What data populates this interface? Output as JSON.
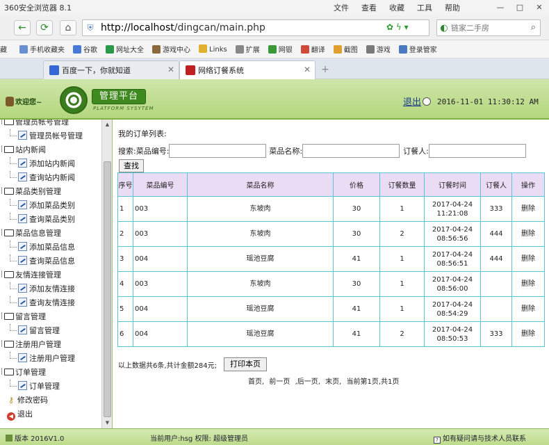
{
  "browser": {
    "app_title": "360安全浏览器 8.1",
    "menus": [
      "文件",
      "查看",
      "收藏",
      "工具",
      "帮助"
    ],
    "url_host": "http://localhost",
    "url_path": "/dingcan/main.php",
    "search_placeholder": "链家二手房",
    "favorites": [
      {
        "label": "藏",
        "color": "#d7a12a"
      },
      {
        "label": "手机收藏夹",
        "color": "#6a8fd0"
      },
      {
        "label": "谷歌",
        "color": "#4a78d6"
      },
      {
        "label": "网址大全",
        "color": "#2a9a4a"
      },
      {
        "label": "游戏中心",
        "color": "#8a6a3a"
      },
      {
        "label": "Links",
        "color": "#e0b030"
      },
      {
        "label": "扩展",
        "color": "#888888"
      },
      {
        "label": "网银",
        "color": "#3a9a3a"
      },
      {
        "label": "翻译",
        "color": "#d04a3a"
      },
      {
        "label": "截图",
        "color": "#e0a030"
      },
      {
        "label": "游戏",
        "color": "#7a7a7a"
      },
      {
        "label": "登录管家",
        "color": "#4a7ac0"
      }
    ],
    "tabs": [
      {
        "label": "百度一下，你就知道",
        "icon_color": "#3466d6"
      },
      {
        "label": "网络订餐系统",
        "icon_color": "#c02020"
      }
    ],
    "accent": "#7fb03f"
  },
  "header": {
    "welcome": "欢迎您~",
    "brand": "管理平台",
    "brand_sub": "PLATFORM SYSYTEM",
    "logout": "退出",
    "datetime": "2016-11-01 11:30:12 AM"
  },
  "sidebar": {
    "items": [
      {
        "label": "管理员帐号管理",
        "level": 0
      },
      {
        "label": "管理员帐号管理",
        "level": 1
      },
      {
        "label": "站内新闻",
        "level": 0
      },
      {
        "label": "添加站内新闻",
        "level": 1
      },
      {
        "label": "查询站内新闻",
        "level": 1
      },
      {
        "label": "菜品类别管理",
        "level": 0
      },
      {
        "label": "添加菜品类别",
        "level": 1
      },
      {
        "label": "查询菜品类别",
        "level": 1
      },
      {
        "label": "菜品信息管理",
        "level": 0
      },
      {
        "label": "添加菜品信息",
        "level": 1
      },
      {
        "label": "查询菜品信息",
        "level": 1
      },
      {
        "label": "友情连接管理",
        "level": 0
      },
      {
        "label": "添加友情连接",
        "level": 1
      },
      {
        "label": "查询友情连接",
        "level": 1
      },
      {
        "label": "留言管理",
        "level": 0
      },
      {
        "label": "留言管理",
        "level": 1
      },
      {
        "label": "注册用户管理",
        "level": 0
      },
      {
        "label": "注册用户管理",
        "level": 1
      },
      {
        "label": "订单管理",
        "level": 0
      },
      {
        "label": "订单管理",
        "level": 1
      },
      {
        "label": "修改密码",
        "level": 2
      },
      {
        "label": "退出",
        "level": 3
      }
    ]
  },
  "main": {
    "list_title": "我的订单列表:",
    "search": {
      "prefix": "搜索:菜品编号:",
      "name_label": "菜品名称:",
      "orderer_label": "订餐人:",
      "button": "查找"
    },
    "table": {
      "headers": [
        "序号",
        "菜品编号",
        "菜品名称",
        "价格",
        "订餐数量",
        "订餐时间",
        "订餐人",
        "操作"
      ],
      "rows": [
        {
          "no": "1",
          "code": "003",
          "name": "东坡肉",
          "price": "30",
          "qty": "1",
          "date": "2017-04-24",
          "time": "11:21:08",
          "user": "333",
          "action": "删除"
        },
        {
          "no": "2",
          "code": "003",
          "name": "东坡肉",
          "price": "30",
          "qty": "2",
          "date": "2017-04-24",
          "time": "08:56:56",
          "user": "444",
          "action": "删除"
        },
        {
          "no": "3",
          "code": "004",
          "name": "瑶池豆腐",
          "price": "41",
          "qty": "1",
          "date": "2017-04-24",
          "time": "08:56:51",
          "user": "444",
          "action": "删除"
        },
        {
          "no": "4",
          "code": "003",
          "name": "东坡肉",
          "price": "30",
          "qty": "1",
          "date": "2017-04-24",
          "time": "08:56:00",
          "user": "",
          "action": "删除"
        },
        {
          "no": "5",
          "code": "004",
          "name": "瑶池豆腐",
          "price": "41",
          "qty": "1",
          "date": "2017-04-24",
          "time": "08:54:29",
          "user": "",
          "action": "删除"
        },
        {
          "no": "6",
          "code": "004",
          "name": "瑶池豆腐",
          "price": "41",
          "qty": "2",
          "date": "2017-04-24",
          "time": "08:50:53",
          "user": "333",
          "action": "删除"
        }
      ]
    },
    "summary": "以上数据共6条,共计金额284元;",
    "print_button": "打印本页",
    "pager": [
      "首页,",
      "前一页",
      ",后一页,",
      "末页,",
      "当前第1页,共1页"
    ]
  },
  "status": {
    "version": "版本 2016V1.0",
    "current_user": "当前用户:hsg 权限: 超级管理员",
    "help": "如有疑问请与技术人员联系"
  }
}
